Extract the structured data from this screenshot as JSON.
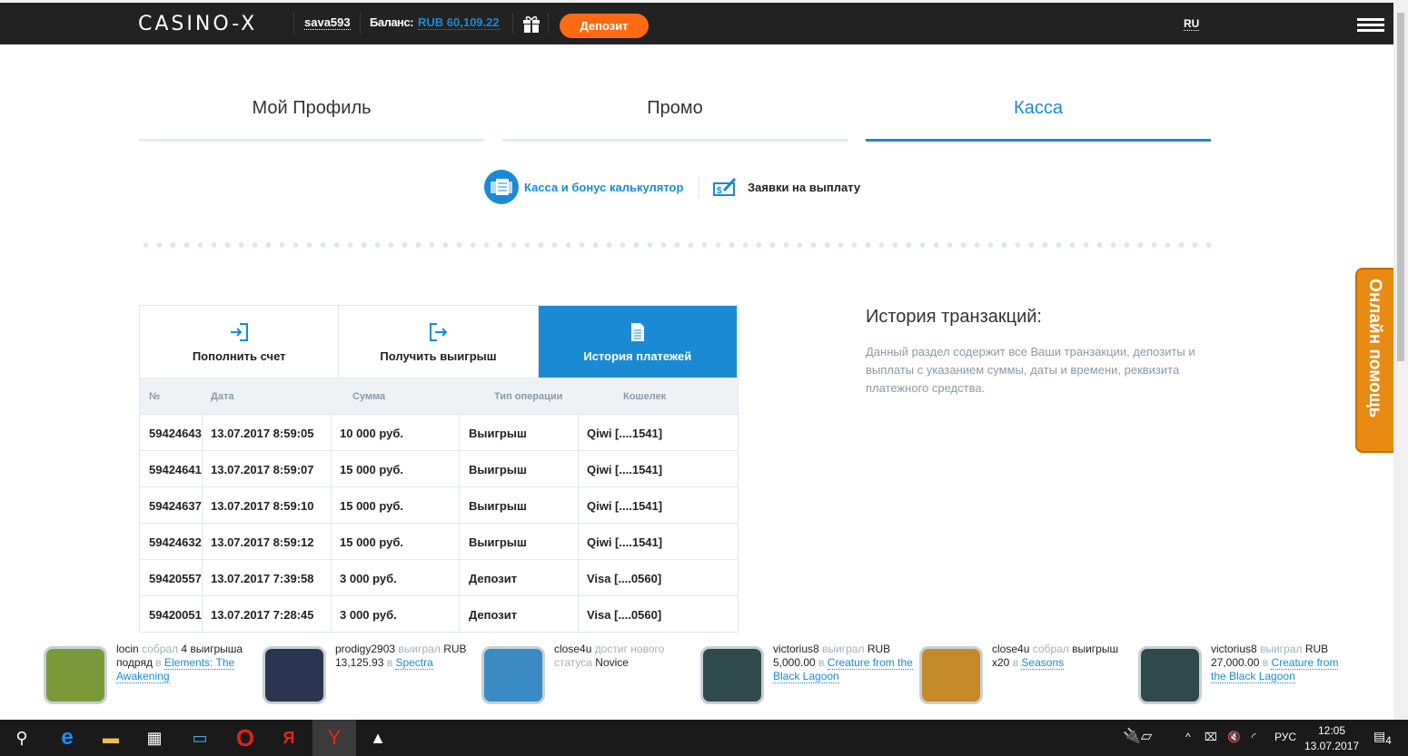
{
  "header": {
    "logo": "CASINO-X",
    "username": "sava593",
    "balance_label": "Баланс:",
    "balance": "RUB 60,109.22",
    "deposit_label": "Депозит",
    "language": "RU"
  },
  "tabs": [
    {
      "label": "Мой Профиль"
    },
    {
      "label": "Промо"
    },
    {
      "label": "Касса",
      "active": true
    }
  ],
  "subnav": {
    "calculator": "Касса и бонус калькулятор",
    "withdraw_requests": "Заявки на выплату"
  },
  "payment_tabs": [
    {
      "label": "Пополнить счет",
      "icon": "sign-in-icon"
    },
    {
      "label": "Получить выигрыш",
      "icon": "sign-out-icon"
    },
    {
      "label": "История платежей",
      "icon": "document-icon",
      "active": true
    }
  ],
  "table": {
    "headers": [
      "№",
      "Дата",
      "Сумма",
      "Тип операции",
      "Кошелек"
    ],
    "rows": [
      [
        "59424643",
        "13.07.2017 8:59:05",
        "10 000 руб.",
        "Выигрыш",
        "Qiwi [....1541]"
      ],
      [
        "59424641",
        "13.07.2017 8:59:07",
        "15 000 руб.",
        "Выигрыш",
        "Qiwi [....1541]"
      ],
      [
        "59424637",
        "13.07.2017 8:59:10",
        "15 000 руб.",
        "Выигрыш",
        "Qiwi [....1541]"
      ],
      [
        "59424632",
        "13.07.2017 8:59:12",
        "15 000 руб.",
        "Выигрыш",
        "Qiwi [....1541]"
      ],
      [
        "59420557",
        "13.07.2017 7:39:58",
        "3 000 руб.",
        "Депозит",
        "Visa [....0560]"
      ],
      [
        "59420051",
        "13.07.2017 7:28:45",
        "3 000 руб.",
        "Депозит",
        "Visa [....0560]"
      ]
    ]
  },
  "history": {
    "title": "История транзакций:",
    "text": "Данный раздел содержит все Ваши транзакции, депозиты и выплаты с указанием суммы, даты и времени, реквизита платежного средства."
  },
  "help_label": "Онлайн помощь",
  "feed": [
    {
      "user": "locin",
      "verb": "собрал",
      "rest": "4 выигрыша подряд",
      "prep": "в",
      "game": "Elements: The Awakening",
      "color": "#7a9a3a"
    },
    {
      "user": "prodigy2903",
      "verb": "выиграл",
      "rest": "RUB 13,125.93",
      "prep": "в",
      "game": "Spectra",
      "color": "#2a3550"
    },
    {
      "user": "close4u",
      "verb": "достиг нового статуса",
      "rest": "Novice",
      "prep": "",
      "game": "",
      "color": "#3a8ac4"
    },
    {
      "user": "victorius8",
      "verb": "выиграл",
      "rest": "RUB 5,000.00",
      "prep": "в",
      "game": "Creature from the Black Lagoon",
      "color": "#2f4a4a"
    },
    {
      "user": "close4u",
      "verb": "собрал",
      "rest": "выигрыш x20",
      "prep": "в",
      "game": "Seasons",
      "color": "#c48a2a"
    },
    {
      "user": "victorius8",
      "verb": "выиграл",
      "rest": "RUB 27,000.00",
      "prep": "в",
      "game": "Creature from the Black Lagoon",
      "color": "#2f4a4a"
    }
  ],
  "taskbar": {
    "language": "РУС",
    "time": "12:05",
    "date": "13.07.2017",
    "notifications": "4"
  },
  "colors": {
    "accent": "#1a8ad4",
    "deposit": "#ff6a13",
    "help": "#e98a12"
  }
}
